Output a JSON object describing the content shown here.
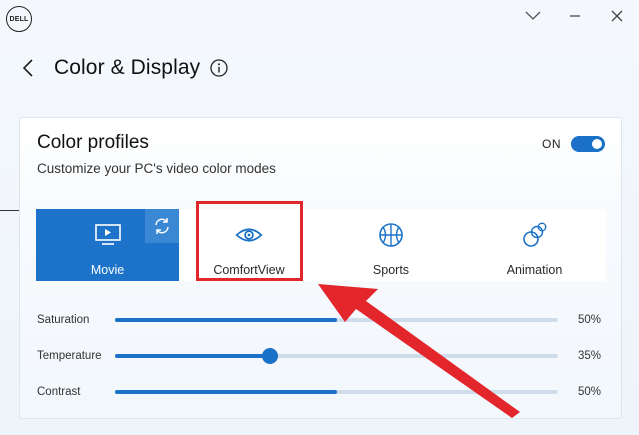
{
  "app": {
    "logo_text": "DELL"
  },
  "header": {
    "title": "Color & Display"
  },
  "card": {
    "title": "Color profiles",
    "subtitle": "Customize your PC's video color modes",
    "toggle_label": "ON",
    "toggle_on": true
  },
  "profiles": [
    {
      "label": "Movie",
      "icon": "monitor-play-icon",
      "active": true
    },
    {
      "label": "ComfortView",
      "icon": "eye-icon",
      "active": false
    },
    {
      "label": "Sports",
      "icon": "basketball-icon",
      "active": false
    },
    {
      "label": "Animation",
      "icon": "animation-circles-icon",
      "active": false
    }
  ],
  "sliders": [
    {
      "label": "Saturation",
      "value": 50,
      "value_text": "50%",
      "show_thumb": false
    },
    {
      "label": "Temperature",
      "value": 35,
      "value_text": "35%",
      "show_thumb": true
    },
    {
      "label": "Contrast",
      "value": 50,
      "value_text": "50%",
      "show_thumb": false
    }
  ],
  "colors": {
    "accent": "#1b71c7",
    "annotation": "#e3262c"
  }
}
